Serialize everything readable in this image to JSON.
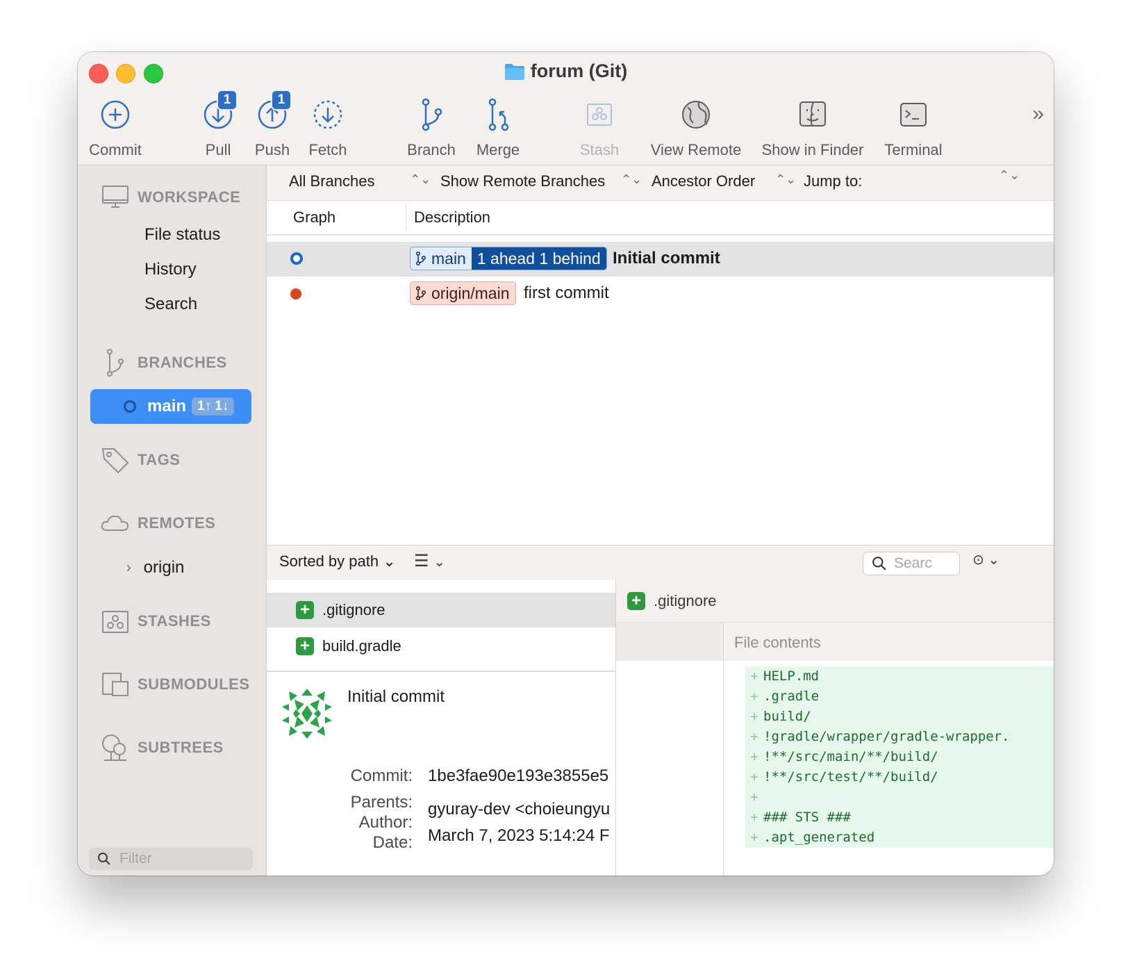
{
  "window": {
    "title": "forum (Git)"
  },
  "toolbar": {
    "commit": "Commit",
    "pull": "Pull",
    "pull_badge": "1",
    "push": "Push",
    "push_badge": "1",
    "fetch": "Fetch",
    "branch": "Branch",
    "merge": "Merge",
    "stash": "Stash",
    "view_remote": "View Remote",
    "show_in_finder": "Show in Finder",
    "terminal": "Terminal",
    "more": "»"
  },
  "sidebar": {
    "workspace": {
      "heading": "WORKSPACE",
      "items": [
        "File status",
        "History",
        "Search"
      ]
    },
    "branches": {
      "heading": "BRANCHES",
      "selected": {
        "name": "main",
        "ahead_behind": "1↑ 1↓"
      }
    },
    "tags": {
      "heading": "TAGS"
    },
    "remotes": {
      "heading": "REMOTES",
      "items": [
        "origin"
      ]
    },
    "stashes": {
      "heading": "STASHES"
    },
    "submodules": {
      "heading": "SUBMODULES"
    },
    "subtrees": {
      "heading": "SUBTREES"
    },
    "filter_placeholder": "Filter"
  },
  "filter_bar": {
    "branches": "All Branches",
    "remote": "Show Remote Branches",
    "order": "Ancestor Order",
    "jump": "Jump to:"
  },
  "columns": {
    "graph": "Graph",
    "description": "Description"
  },
  "commits": [
    {
      "branch": "main",
      "status": "1 ahead 1 behind",
      "message": "Initial commit"
    },
    {
      "branch": "origin/main",
      "message": "first commit"
    }
  ],
  "lower_bar": {
    "sort": "Sorted by path",
    "search_placeholder": "Searc"
  },
  "files": [
    ".gitignore",
    "build.gradle"
  ],
  "details": {
    "title": "Initial commit",
    "commit_label": "Commit:",
    "commit_value": "1be3fae90e193e3855e5",
    "parents_label": "Parents:",
    "author_label": "Author:",
    "author_value": "gyuray-dev <choieungyu",
    "date_label": "Date:",
    "date_value": "March 7, 2023 5:14:24 F"
  },
  "diff": {
    "file": ".gitignore",
    "hunk_header": "File contents",
    "lines": [
      "HELP.md",
      ".gradle",
      "build/",
      "!gradle/wrapper/gradle-wrapper.",
      "!**/src/main/**/build/",
      "!**/src/test/**/build/",
      "",
      "### STS ###",
      ".apt_generated"
    ]
  },
  "colors": {
    "accent": "#3e8ef7",
    "local_branch": "#0f4f9c",
    "remote_branch": "#fbdcd5",
    "added": "#2f9a3d"
  }
}
